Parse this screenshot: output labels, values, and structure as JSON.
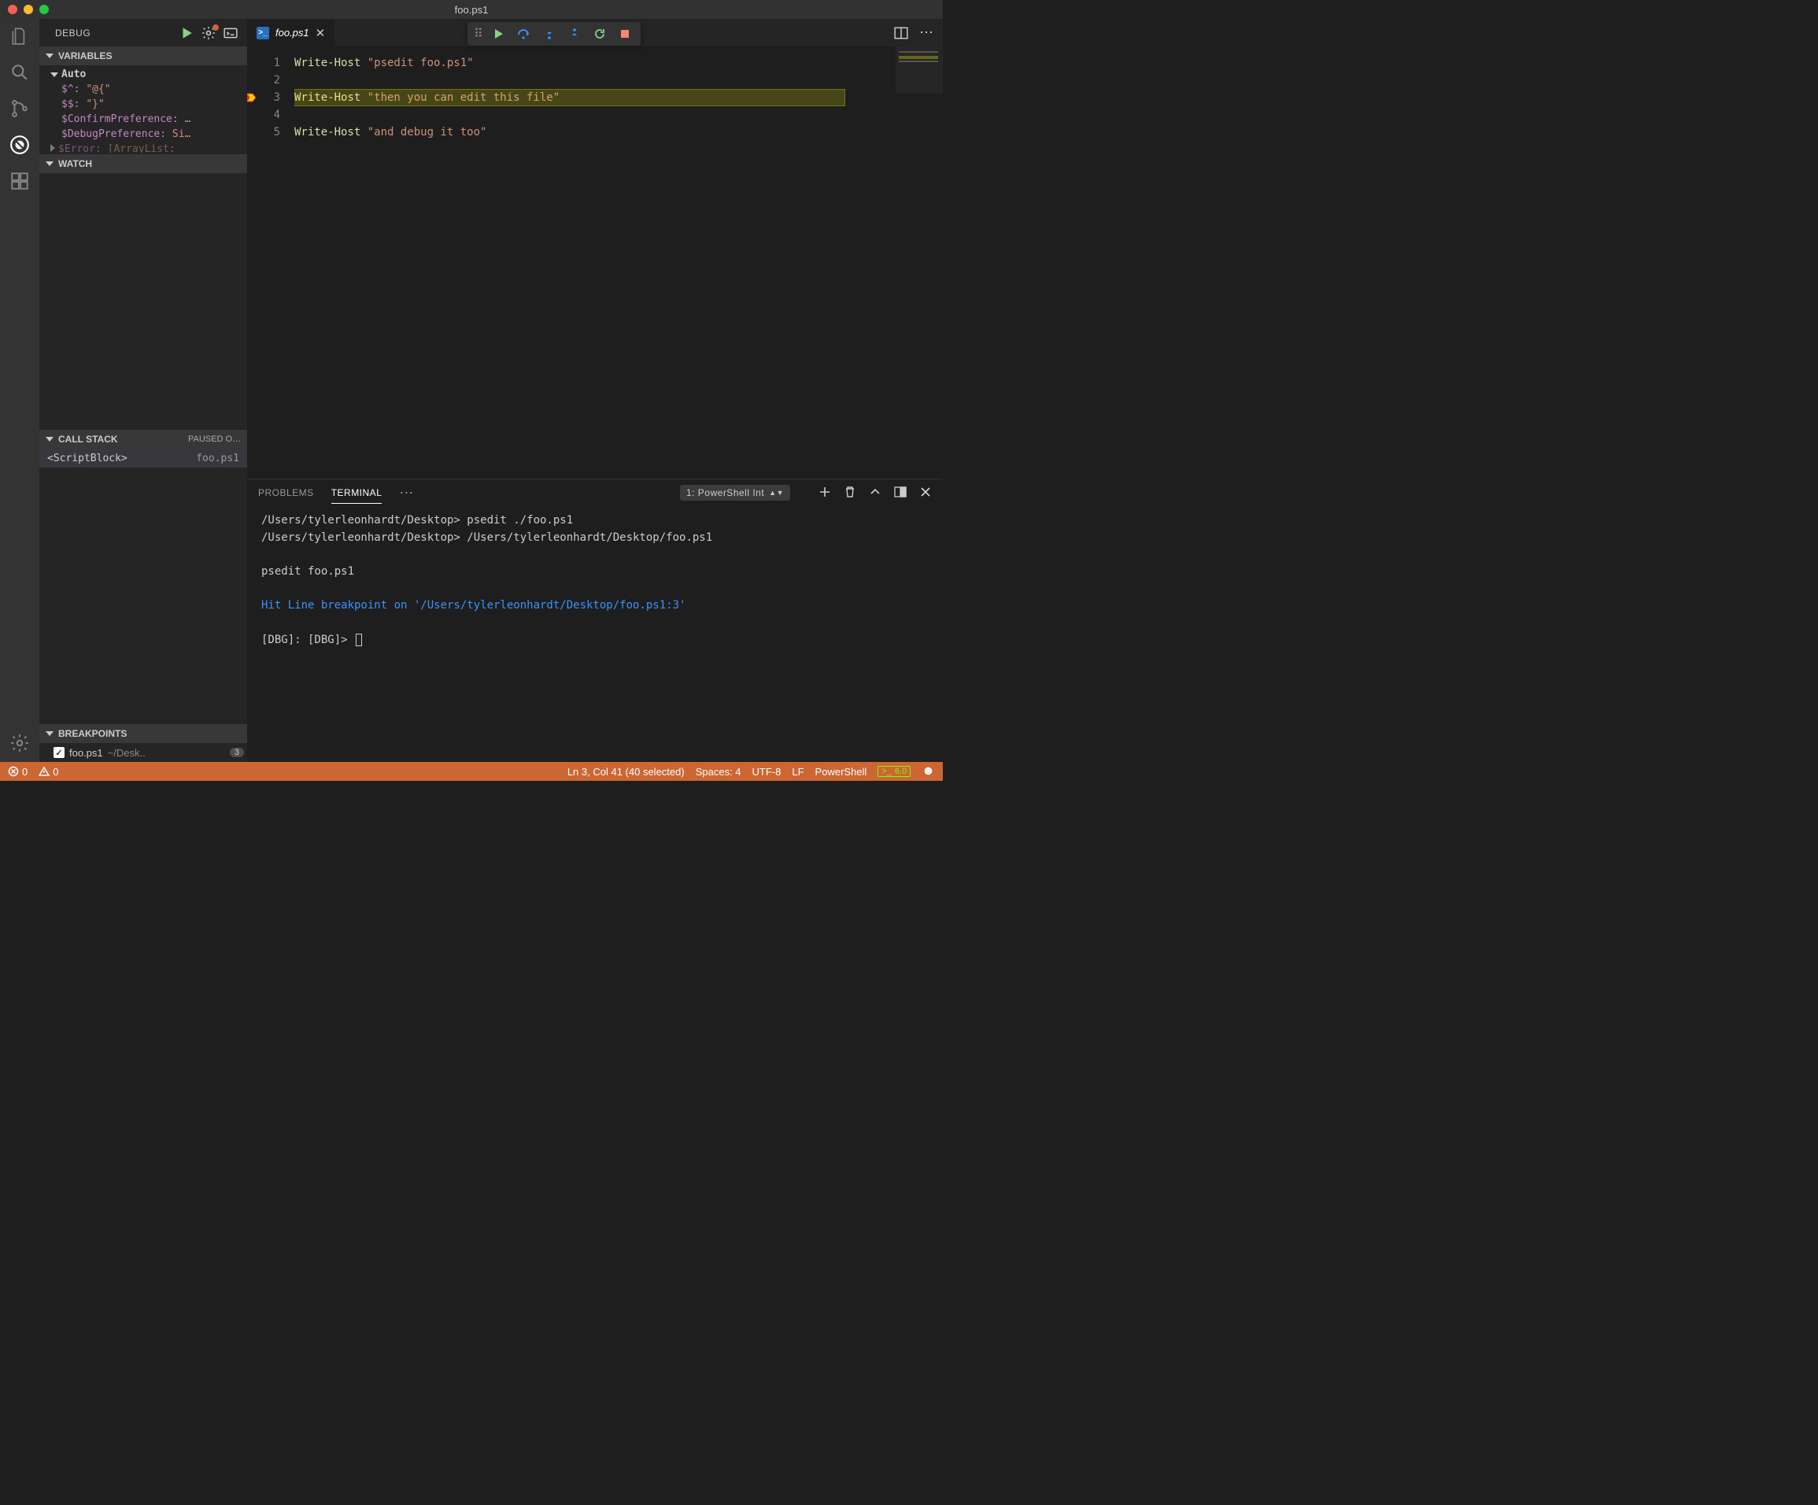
{
  "window": {
    "title": "foo.ps1"
  },
  "activitybar": {
    "items": [
      "explorer",
      "search",
      "scm",
      "debug",
      "extensions"
    ],
    "bottom": "settings"
  },
  "debug_sidebar": {
    "title": "DEBUG",
    "sections": {
      "variables": {
        "label": "VARIABLES",
        "scope": "Auto",
        "rows": [
          {
            "name": "$^:",
            "value": "\"@{\""
          },
          {
            "name": "$$:",
            "value": "\"}\""
          },
          {
            "name": "$ConfirmPreference:",
            "value": "…"
          },
          {
            "name": "$DebugPreference:",
            "value": "Si…"
          },
          {
            "name": "$Error:",
            "value": "[ArrayList:"
          }
        ]
      },
      "watch": {
        "label": "WATCH"
      },
      "callstack": {
        "label": "CALL STACK",
        "status": "PAUSED O…",
        "frames": [
          {
            "name": "<ScriptBlock>",
            "file": "foo.ps1"
          }
        ]
      },
      "breakpoints": {
        "label": "BREAKPOINTS",
        "items": [
          {
            "checked": true,
            "file": "foo.ps1",
            "path": "~/Desk..",
            "line": "3"
          }
        ]
      }
    }
  },
  "tabs": [
    {
      "label": "foo.ps1",
      "active": true
    }
  ],
  "debug_toolbar": {
    "buttons": [
      "continue",
      "step-over",
      "step-into",
      "step-out",
      "restart",
      "stop"
    ]
  },
  "code": {
    "lines": [
      {
        "n": "1",
        "segments": [
          {
            "t": "Write-Host ",
            "c": "cmd"
          },
          {
            "t": "\"psedit foo.ps1\"",
            "c": "str"
          }
        ]
      },
      {
        "n": "2",
        "segments": []
      },
      {
        "n": "3",
        "segments": [
          {
            "t": "Write-Host ",
            "c": "cmd"
          },
          {
            "t": "\"then you can edit this file\"",
            "c": "str"
          }
        ],
        "current": true,
        "breakpoint": true
      },
      {
        "n": "4",
        "segments": []
      },
      {
        "n": "5",
        "segments": [
          {
            "t": "Write-Host ",
            "c": "cmd"
          },
          {
            "t": "\"and debug it too\"",
            "c": "str"
          }
        ]
      }
    ]
  },
  "panel": {
    "tabs": {
      "problems": "PROBLEMS",
      "terminal": "TERMINAL"
    },
    "terminal_selector": "1: PowerShell Int",
    "terminal_lines": [
      {
        "text": "/Users/tylerleonhardt/Desktop> psedit ./foo.ps1",
        "cls": ""
      },
      {
        "text": "/Users/tylerleonhardt/Desktop> /Users/tylerleonhardt/Desktop/foo.ps1",
        "cls": ""
      },
      {
        "text": "",
        "cls": ""
      },
      {
        "text": "psedit foo.ps1",
        "cls": ""
      },
      {
        "text": "",
        "cls": ""
      },
      {
        "text": "Hit Line breakpoint on '/Users/tylerleonhardt/Desktop/foo.ps1:3'",
        "cls": "blue"
      },
      {
        "text": "",
        "cls": ""
      },
      {
        "text": "[DBG]:  [DBG]> ",
        "cls": "prompt"
      }
    ]
  },
  "statusbar": {
    "errors": "0",
    "warnings": "0",
    "position": "Ln 3, Col 41 (40 selected)",
    "spaces": "Spaces: 4",
    "encoding": "UTF-8",
    "eol": "LF",
    "language": "PowerShell",
    "ps_version": "6.0"
  }
}
